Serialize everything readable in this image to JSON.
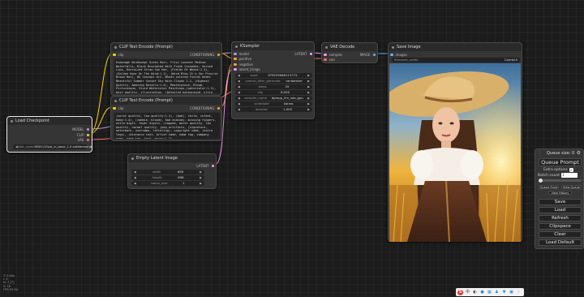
{
  "colors": {
    "model": "#b39ddb",
    "clip": "#ffd500",
    "vae": "#ff6e6e",
    "conditioning": "#ffa931",
    "latent": "#ff9cf9",
    "image": "#64b5f6",
    "node_bg": "#353535",
    "canvas_bg": "#1b1b1b"
  },
  "load_checkpoint": {
    "title": "Load Checkpoint",
    "outputs": [
      "MODEL",
      "CLIP",
      "VAE"
    ],
    "ckpt_label": "ckpt_name",
    "ckpt_value": "SDXL\\10\\sd_xl_base_1.0.safetensors"
  },
  "clip_pos": {
    "title": "CLIP Text Encode (Prompt)",
    "input": "clip",
    "output": "CONDITIONING",
    "text": "Kimonagh Windswept Green Hair, Frizz Loosest Medium Waterfalls, Black Brocheted With Fresh Cockades, Varied Lips, Oversized Straw Sun Hat, (Fields Of Wheat:1.4), (Golden Hour On The Wind:1.1), (Wind Blow It's Ser Prairie Brown Hat), 8k Concept Art, Wheat-colored Fields Under Beautiful Summer Sunset Sky With Clouds 1.2, (Highest Quality, Amazing Details:1.4), Masterpiece, Bloom, Picturesque, Vivid Watercolor Paintings,(watercolor:1.5), best quality, illustration, (Detailed background, ultra detailed, beautiful and aesthetic, ((masterpiece)) 1.4)"
  },
  "clip_neg": {
    "title": "CLIP Text Encode (Prompt)",
    "input": "clip",
    "output": "CONDITIONING",
    "text": "(worst quality, low quality:1.4), (bad), child, infant, baby:1.4), (zombie, bloody, bad anatomy, missing fingers, extra digit, fewer digits, cropped, worst quality, low quality, normal quality, jpeg artifacts, (signature, watermark, username, lettering), copyright name, (extra legs), (distance text, artist name, name tag, company name, name tag, text, error:1.3)"
  },
  "ksampler": {
    "title": "KSampler",
    "inputs": [
      "model",
      "positive",
      "negative",
      "latent_image"
    ],
    "output": "LATENT",
    "widgets": [
      {
        "label": "seed",
        "value": "979239968113772"
      },
      {
        "label": "control_after_generate",
        "value": "randomize"
      },
      {
        "label": "steps",
        "value": "25"
      },
      {
        "label": "cfg",
        "value": "8.000"
      },
      {
        "label": "sampler_name",
        "value": "dpmpp_2m_sde_gpu"
      },
      {
        "label": "scheduler",
        "value": "karras"
      },
      {
        "label": "denoise",
        "value": "1.000"
      }
    ]
  },
  "vae_decode": {
    "title": "VAE Decode",
    "inputs": [
      "samples",
      "vae"
    ],
    "output": "IMAGE"
  },
  "save_image": {
    "title": "Save Image",
    "input": "images",
    "prefix_label": "filename_prefix",
    "prefix_value": "ComfyUI"
  },
  "empty_latent": {
    "title": "Empty Latent Image",
    "output": "LATENT",
    "widgets": [
      {
        "label": "width",
        "value": "896"
      },
      {
        "label": "height",
        "value": "896"
      },
      {
        "label": "batch_size",
        "value": "1"
      }
    ]
  },
  "queue_panel": {
    "queue_size": "Queue size: 0",
    "queue_prompt": "Queue Prompt",
    "extra_options": "Extra options",
    "batch_count_label": "Batch count",
    "batch_count_value": "1",
    "queue_front": "Queue Front",
    "view_queue": "View Queue",
    "view_history": "View History",
    "save": "Save",
    "load": "Load",
    "refresh": "Refresh",
    "clipspace": "Clipspace",
    "clear": "Clear",
    "load_default": "Load Default"
  },
  "stats": [
    "T: 0.00s",
    "I: 0",
    "N: 7 [7]",
    "V: 18",
    "FPS:59.94"
  ]
}
